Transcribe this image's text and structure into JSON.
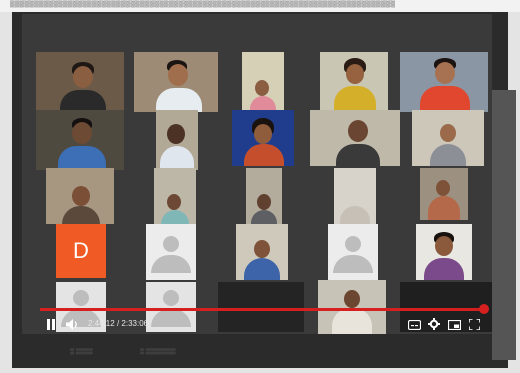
{
  "player": {
    "current_time": "2:44:12",
    "duration": "2:33:06",
    "time_separator": "/",
    "progress_fraction": 0.99
  },
  "participants": {
    "initial_tile_letter": "D"
  },
  "icons": {
    "pause": "pause-icon",
    "volume": "volume-icon",
    "subtitles": "subtitles-icon",
    "settings": "gear-icon",
    "miniplayer": "miniplayer-icon",
    "fullscreen": "fullscreen-icon"
  },
  "colors": {
    "progress": "#d62020",
    "initial_tile": "#f05a24"
  }
}
